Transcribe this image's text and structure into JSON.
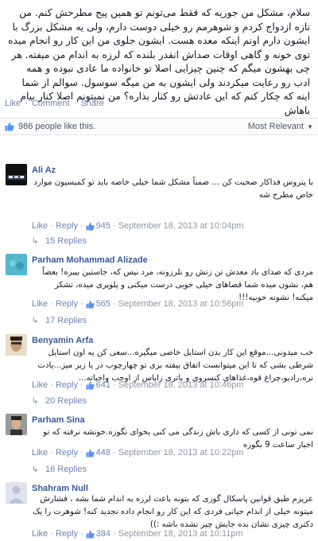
{
  "post": {
    "text": "سلام، مشکل من جوریه که فقط می‌تونم تو همین پیج مطرحش کنم. من تازه ازدواج کردم و شوهرمم رو خیلی دوست دارم، ولی یه مشکل بزرگ با ایشون دارم اونم اینکه معده هست. ایشون جلوی من این کار رو انجام میده توی خونه و گاهی اوقات صداش انقدر بلنده که لرزه به اندام من میفته. هر چی بهشون میگم که چنین چیزایی اصلا تو خانواده ما عادی نبوده و همه ادب رو رعایت میکردند ولی ایشون به من میگه سوسول. سوالم از شما اینه که چکار کنم که این عادتش رو کنار بذاره؟ من نمیتونم اصلا کنار بیام باهاش",
    "actions": {
      "like": "Like",
      "comment": "Comment",
      "share": "Share",
      "sep": "·"
    }
  },
  "likes_bar": {
    "text": "986 people like this.",
    "sort_label": "Most Relevant",
    "sort_caret": "▼"
  },
  "comments": [
    {
      "author": "Ali Az",
      "text": "با پتروس فداکار صحبت کن ... ضمناً مشکل شما خیلی خاصه باید تو کمیسیون موارد خاص مطرح شه",
      "like_label": "Like",
      "reply_label": "Reply",
      "likes": "945",
      "timestamp": "September 18, 2013 at 10:04pm",
      "replies": "15 Replies",
      "dot": "·"
    },
    {
      "author": "Parham Mohammad Alizade",
      "text": "مردی که صدای باد معدش تن زنش رو نلرزونه، مرد نیس که، جاستین بیبره! بعضاً هم، نشون میده شما قصاهای خیلی خوبی درست میکنی و پلوپری میده، تشکر میکنه! نشونه خوبیه!!!",
      "like_label": "Like",
      "reply_label": "Reply",
      "likes": "565",
      "timestamp": "September 18, 2013 at 10:56pm",
      "replies": "17 Replies",
      "dot": "·"
    },
    {
      "author": "Benyamin Arfa",
      "text": "خب میدونی...موقع این کار بدن استایل خاصی میگیره...سعی کن یه اون استایل شرطی بشی که تا این میتوانست اتفاق بیفته بری تو چهارچوب در یا زیر میز...یادت نره،رادیو،چراغ قوه،غذاهای کنسروی و باتری زاپاس از اوجب واجباته...",
      "like_label": "Like",
      "reply_label": "Reply",
      "likes": "641",
      "timestamp": "September 18, 2013 at 10:46pm",
      "replies": "20 Replies",
      "dot": "·"
    },
    {
      "author": "Parham Sina",
      "text": "نمی تونی از کسی که داری باش زندگی می کنی بخوای نگوزه.خونشه نرفته که تو اخبار ساعت 9 بگوزه",
      "like_label": "Like",
      "reply_label": "Reply",
      "likes": "448",
      "timestamp": "September 18, 2013 at 10:22pm",
      "replies": "16 Replies",
      "dot": "·"
    },
    {
      "author": "Shahram Null",
      "text": "عزیزم طبق قوانین پاسکال گوزی که بتونه باعث لرزه به اندام شما بشه ، فشارش میتونه خیلی از اندام حیاتی فردی که این کار رو انجام داده تجدید کنه! شوهرت را یک دکتری چیزی نشان بده جایش چیز نشده باشه :))",
      "like_label": "Like",
      "reply_label": "Reply",
      "likes": "384",
      "timestamp": "September 18, 2013 at 10:11pm",
      "replies": "",
      "dot": "·"
    }
  ],
  "colors": {
    "link": "#3b5998",
    "action": "#6d84b4",
    "meta": "#9197a3",
    "text": "#141823"
  },
  "icons": [
    "thumbs-up-icon",
    "reply-arrow-icon",
    "chevron-down-icon"
  ]
}
